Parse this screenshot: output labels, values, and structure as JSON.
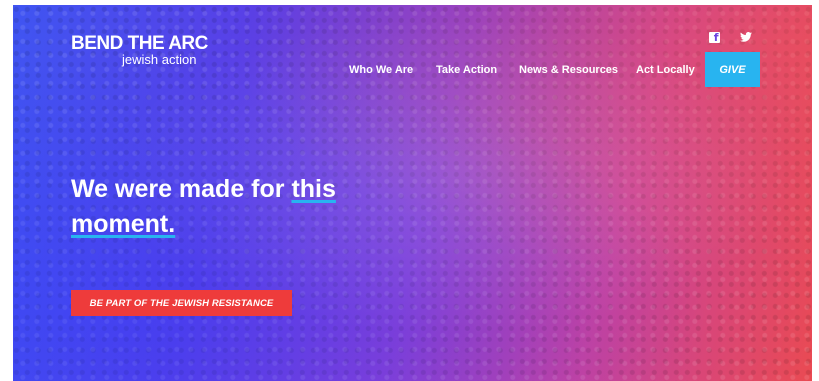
{
  "brand": {
    "name": "BEND THE ARC",
    "tagline": "jewish action"
  },
  "social": [
    {
      "icon": "facebook-icon"
    },
    {
      "icon": "twitter-icon"
    }
  ],
  "nav": {
    "items": [
      "Who We Are",
      "Take Action",
      "News & Resources",
      "Act Locally"
    ],
    "give_label": "GIVE"
  },
  "hero": {
    "headline_line1_prefix": "We were made for ",
    "headline_line1_underlined": "this",
    "headline_line2_underlined": "moment.",
    "cta_label": "BE PART OF THE JEWISH RESISTANCE"
  },
  "colors": {
    "accent_blue": "#28b4f0",
    "cta_red": "#ee3b3b",
    "gradient_start": "#3f55f2",
    "gradient_end": "#ea4a52"
  }
}
